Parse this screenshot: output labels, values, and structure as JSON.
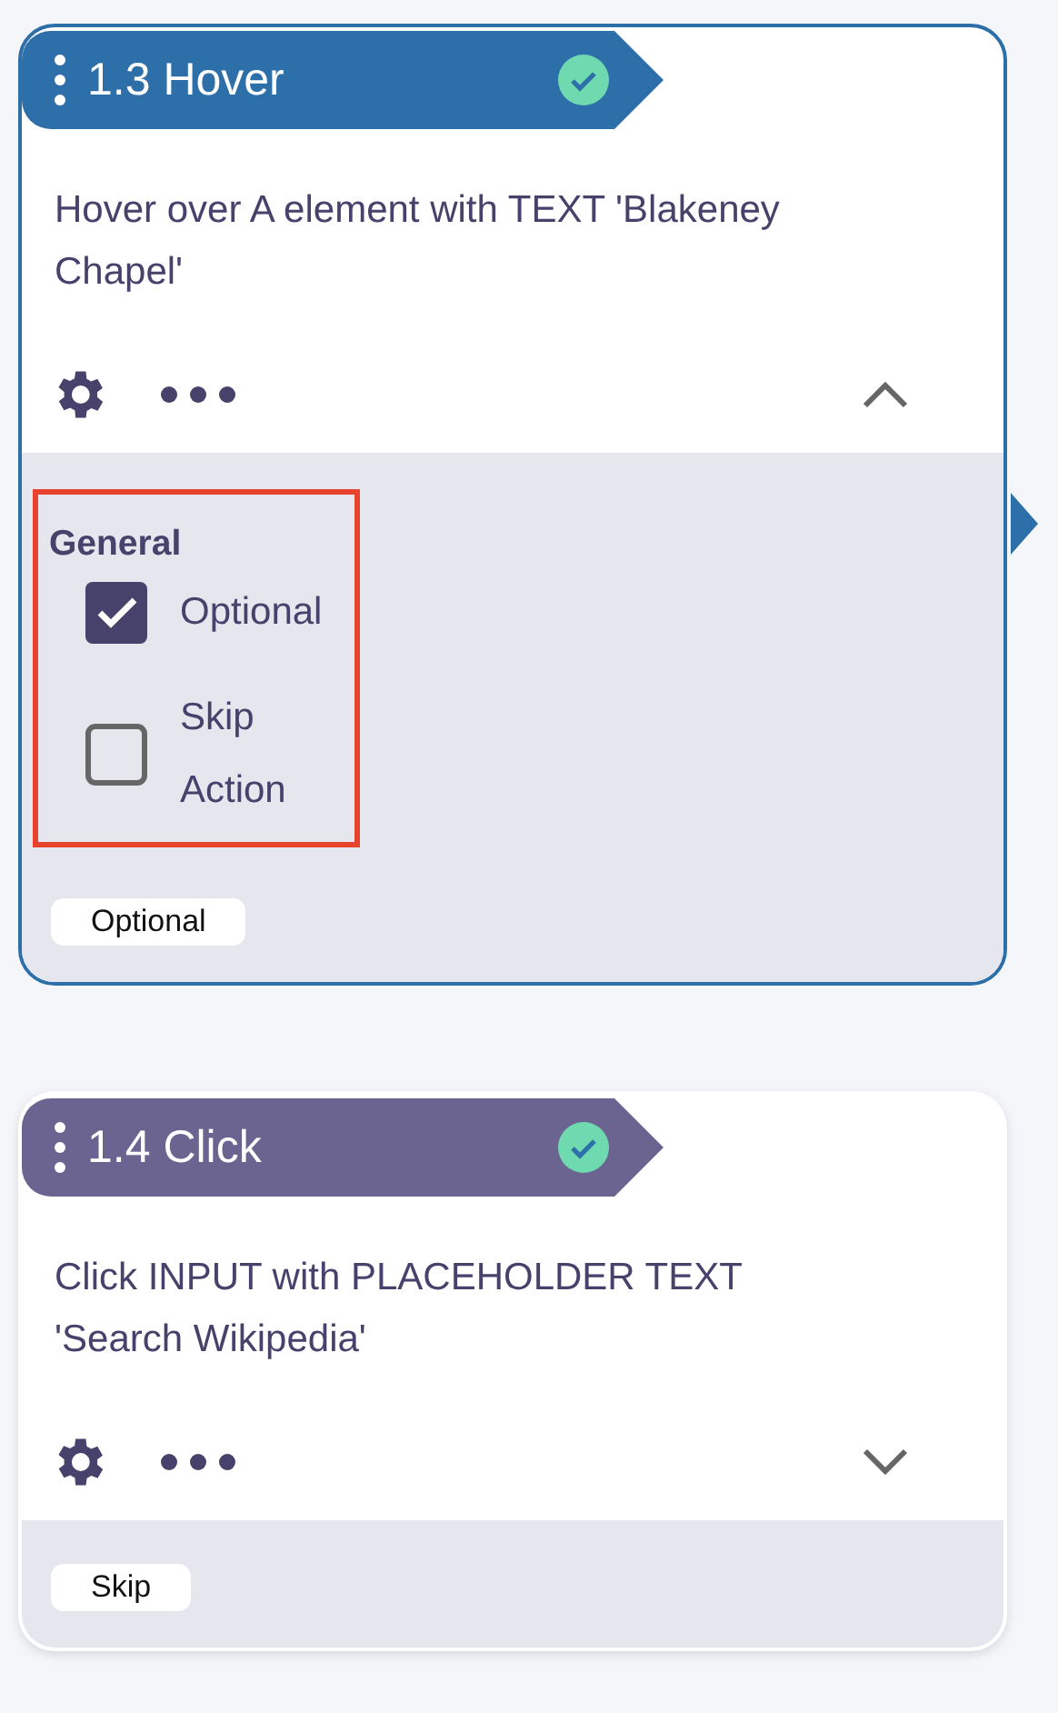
{
  "steps": [
    {
      "title": "1.3 Hover",
      "selected": true,
      "passed": true,
      "description": "Hover over A element with TEXT 'Blakeney Chapel'",
      "expanded": true,
      "settings": {
        "section": "General",
        "highlighted": true,
        "options": [
          {
            "label": "Optional",
            "checked": true
          },
          {
            "label": "Skip Action",
            "checked": false
          }
        ]
      },
      "tags": [
        "Optional"
      ]
    },
    {
      "title": "1.4 Click",
      "selected": false,
      "passed": true,
      "description": "Click INPUT with PLACEHOLDER TEXT 'Search Wikipedia'",
      "expanded": false,
      "tags": [
        "Skip"
      ]
    }
  ]
}
